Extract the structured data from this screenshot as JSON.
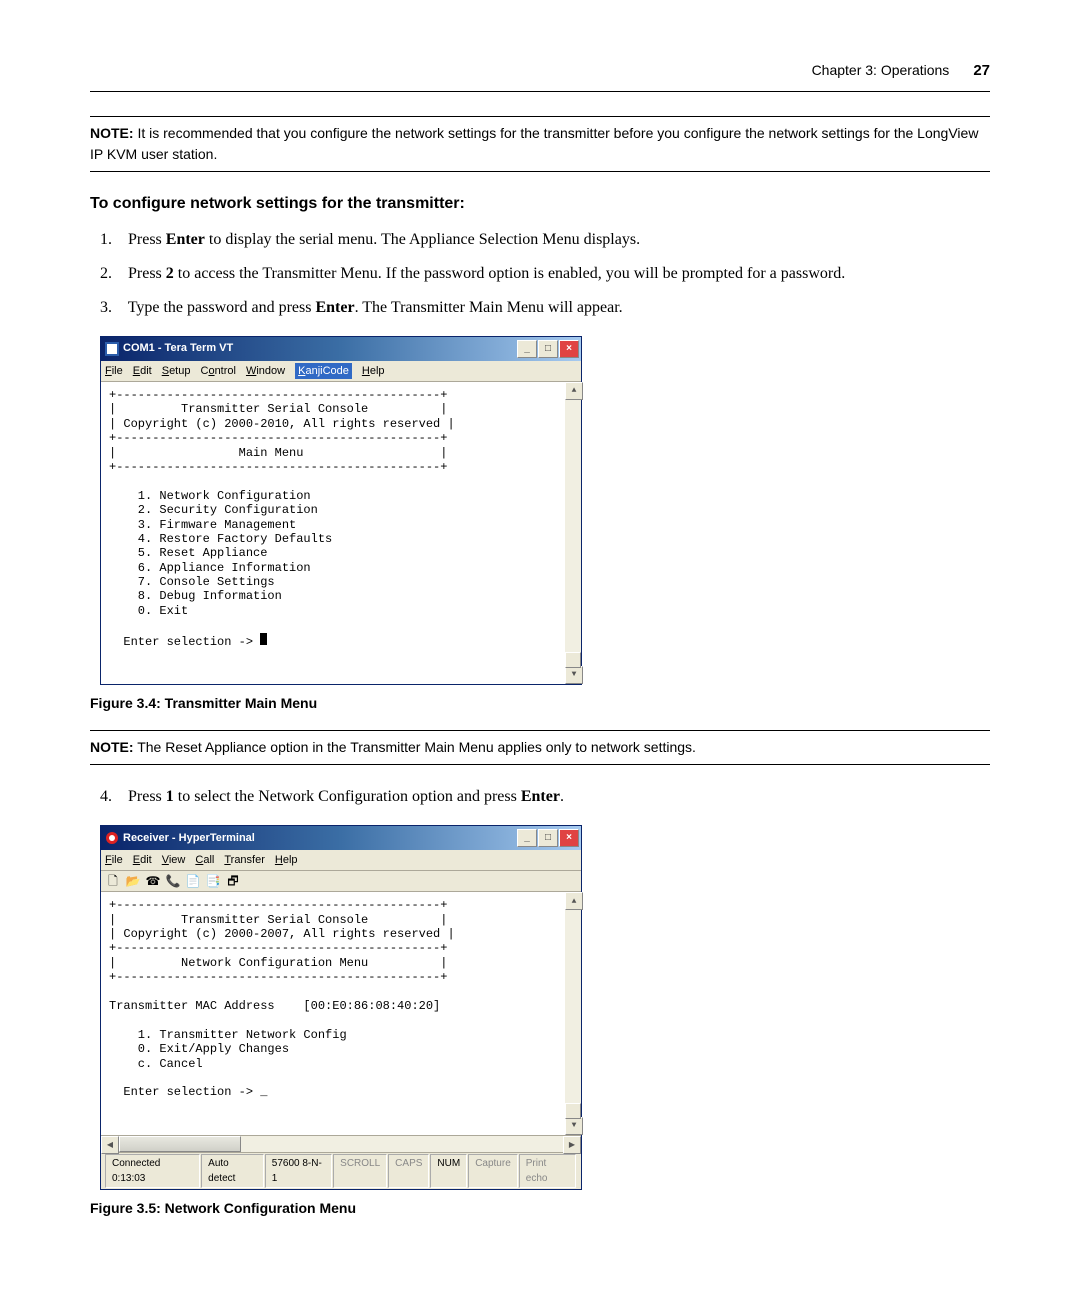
{
  "header": {
    "chapter": "Chapter 3: Operations",
    "page": "27"
  },
  "note1": {
    "prefix": "NOTE:",
    "text": " It is recommended that you configure the network settings for the transmitter before you configure the network settings for the LongView IP KVM user station."
  },
  "heading1": "To configure network settings for the transmitter:",
  "steps1": [
    {
      "num": "1.",
      "pre": "Press ",
      "strong": "Enter",
      "post": " to display the serial menu. The Appliance Selection Menu displays."
    },
    {
      "num": "2.",
      "pre": "Press ",
      "strong": "2",
      "post": " to access the Transmitter Menu. If the password option is enabled, you will be prompted for a password."
    },
    {
      "num": "3.",
      "pre": "Type the password and press ",
      "strong": "Enter",
      "post": ". The Transmitter Main Menu will appear."
    }
  ],
  "term1": {
    "title": "COM1 - Tera Term VT",
    "menu": {
      "file": "File",
      "edit": "Edit",
      "setup": "Setup",
      "control": "Control",
      "window": "Window",
      "kanjicode": "KanjiCode",
      "help": "Help"
    },
    "body": "+---------------------------------------------+\n|         Transmitter Serial Console          |\n| Copyright (c) 2000-2010, All rights reserved |\n+---------------------------------------------+\n|                 Main Menu                   |\n+---------------------------------------------+\n\n    1. Network Configuration\n    2. Security Configuration\n    3. Firmware Management\n    4. Restore Factory Defaults\n    5. Reset Appliance\n    6. Appliance Information\n    7. Console Settings\n    8. Debug Information\n    0. Exit\n\n  Enter selection -> "
  },
  "figure34": "Figure 3.4: Transmitter Main Menu",
  "note2": {
    "prefix": "NOTE:",
    "text": " The Reset Appliance option in the Transmitter Main Menu applies only to network settings."
  },
  "steps2": [
    {
      "num": "4.",
      "pre": "Press ",
      "strong": "1",
      "post": " to select the Network Configuration option and press ",
      "strong2": "Enter",
      "post2": "."
    }
  ],
  "term2": {
    "title": "Receiver - HyperTerminal",
    "menu": {
      "file": "File",
      "edit": "Edit",
      "view": "View",
      "call": "Call",
      "transfer": "Transfer",
      "help": "Help"
    },
    "body": "+---------------------------------------------+\n|         Transmitter Serial Console          |\n| Copyright (c) 2000-2007, All rights reserved |\n+---------------------------------------------+\n|         Network Configuration Menu          |\n+---------------------------------------------+\n\nTransmitter MAC Address    [00:E0:86:08:40:20]\n\n    1. Transmitter Network Config\n    0. Exit/Apply Changes\n    c. Cancel\n\n  Enter selection -> _",
    "status": {
      "connected": "Connected 0:13:03",
      "detect": "Auto detect",
      "baud": "57600 8-N-1",
      "scroll": "SCROLL",
      "caps": "CAPS",
      "num": "NUM",
      "capture": "Capture",
      "print": "Print echo"
    }
  },
  "figure35": "Figure 3.5: Network Configuration Menu"
}
